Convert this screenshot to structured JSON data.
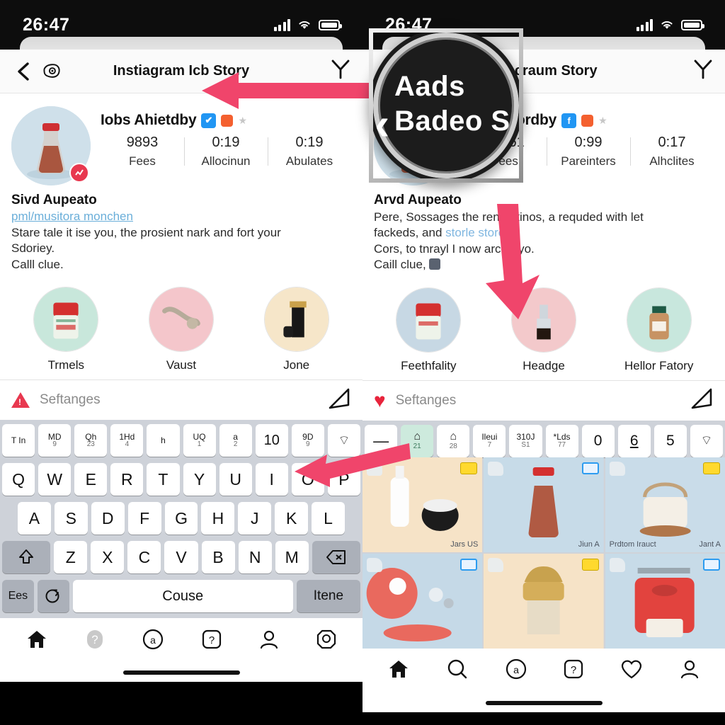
{
  "status_bar": {
    "time": "26:47",
    "signal_icon": "cellular-bars-icon",
    "wifi_icon": "wifi-icon",
    "battery_icon": "battery-icon"
  },
  "left_phone": {
    "nav": {
      "back_icon": "back-chevron-icon",
      "logo_icon": "camera-logo-icon",
      "title": "Instiagram Icb Story",
      "filter_icon": "filter-y-icon"
    },
    "profile": {
      "avatar_icon": "sauce-bottle-avatar",
      "avatar_badge_icon": "reel-badge-icon",
      "username": "Iobs Ahietdby",
      "verified_icon": "verified-check-icon",
      "emoji_icon": "orange-emoji-icon",
      "star_icon": "star-icon",
      "stats": [
        {
          "value": "9893",
          "label": "Fees"
        },
        {
          "value": "0:19",
          "label": "Allocinun"
        },
        {
          "value": "0:19",
          "label": "Abulates"
        }
      ]
    },
    "bio": {
      "title": "Sivd Aupeato",
      "link": "pml/musitora monchen",
      "line1": "Stare tale it ise you, the prosient nark and fort your",
      "line2": "Sdoriey.",
      "line3": "Calll clue."
    },
    "highlights": [
      {
        "label": "Trmels",
        "icon": "red-tin-thumb",
        "badge_icon": "reel-badge-icon"
      },
      {
        "label": "Vaust",
        "icon": "ornament-thumb",
        "badge_icon": "reel-badge-icon"
      },
      {
        "label": "Jone",
        "icon": "black-bottle-thumb",
        "badge_icon": ""
      }
    ],
    "strip": {
      "icon": "warning-triangle-icon",
      "text": "Seftanges",
      "action_icon": "share-arrow-icon"
    },
    "keyboard": {
      "suggestion_row": [
        {
          "main": "T In",
          "sub": ""
        },
        {
          "main": "MD",
          "sub": "9"
        },
        {
          "main": "Qh",
          "sub": "23"
        },
        {
          "main": "1Hd",
          "sub": "4"
        },
        {
          "main": "h",
          "sub": ""
        },
        {
          "main": "UQ",
          "sub": "1"
        },
        {
          "main": "a",
          "sub": "2"
        },
        {
          "main": "10",
          "sub": ""
        },
        {
          "main": "9D",
          "sub": "9"
        },
        {
          "main": "⌔",
          "sub": ""
        }
      ],
      "row1": [
        "Q",
        "W",
        "E",
        "R",
        "T",
        "Y",
        "U",
        "I",
        "O",
        "P"
      ],
      "row2": [
        "A",
        "S",
        "D",
        "F",
        "G",
        "H",
        "J",
        "K",
        "L"
      ],
      "row3": [
        "Z",
        "X",
        "C",
        "V",
        "B",
        "N",
        "M"
      ],
      "shift_icon": "shift-arrow-icon",
      "backspace_icon": "backspace-icon",
      "bottom_left": "Ees",
      "globe_icon": "globe-refresh-icon",
      "space_label": "Couse",
      "return_label": "Itene"
    },
    "tabbar": [
      {
        "icon": "home-icon",
        "active": true
      },
      {
        "icon": "search-icon-disabled",
        "active": false
      },
      {
        "icon": "reels-circle-icon",
        "active": false
      },
      {
        "icon": "question-square-icon",
        "active": false
      },
      {
        "icon": "person-icon",
        "active": false
      },
      {
        "icon": "tagged-frame-icon",
        "active": false
      }
    ]
  },
  "right_phone": {
    "nav": {
      "back_icon": "back-chevron-icon",
      "title": "dsacraum Story",
      "filter_icon": "filter-y-icon"
    },
    "profile": {
      "avatar_icon": "sauce-bottle-avatar",
      "avatar_badge_icon": "reel-badge-icon",
      "username": "oue Ahiordby",
      "verified_icon": "facebook-badge-icon",
      "emoji_icon": "orange-emoji-icon",
      "star_icon": "star-icon",
      "stats": [
        {
          "value": "33661",
          "label": "Fees"
        },
        {
          "value": "0:99",
          "label": "Pareinters"
        },
        {
          "value": "0:17",
          "label": "Alhclites"
        }
      ]
    },
    "bio": {
      "title": "Arvd Aupeato",
      "line1": "Pere, Sossages the renerstinos, a requded with let",
      "line2a": "fackeds, and ",
      "line2_link": "storle store",
      "line2b": ",",
      "line3": "Cors, to tnrayl I now archb-yo.",
      "line4": "Caill clue,"
    },
    "highlights": [
      {
        "label": "Feethfality",
        "icon": "red-tin-thumb",
        "badge_icon": "reel-badge-icon"
      },
      {
        "label": "Headge",
        "icon": "dark-bottle-thumb",
        "badge_icon": ""
      },
      {
        "label": "Hellor Fatory",
        "icon": "jar-thumb",
        "badge_icon": ""
      }
    ],
    "strip": {
      "icon": "heart-filled-icon",
      "text": "Seftanges",
      "action_icon": "share-arrow-icon"
    },
    "keyboard": {
      "suggestion_row": [
        {
          "main": "—",
          "sub": ""
        },
        {
          "main": "⌂",
          "sub": "21"
        },
        {
          "main": "⌂",
          "sub": "28"
        },
        {
          "main": "Ileui",
          "sub": "7"
        },
        {
          "main": "310J",
          "sub": "S1"
        },
        {
          "main": "*Lds",
          "sub": "77"
        },
        {
          "main": "0",
          "sub": ""
        },
        {
          "main": "6",
          "sub": ""
        },
        {
          "main": "5",
          "sub": ""
        },
        {
          "main": "⌔",
          "sub": ""
        }
      ]
    },
    "grid": [
      {
        "caption": "Jars US",
        "tag": "yellow",
        "bg": "cream",
        "thumb": "white-bottle-cup"
      },
      {
        "caption": "Jiun A",
        "tag": "blue",
        "bg": "blue",
        "thumb": "sauce-bottle"
      },
      {
        "caption": "Jant A",
        "caption_left": "Prdtom Irauct",
        "tag": "yellow",
        "bg": "blue",
        "thumb": "basket-jar"
      },
      {
        "caption": "",
        "tag": "blue",
        "bg": "blue",
        "thumb": "red-dish"
      },
      {
        "caption": "",
        "tag": "yellow",
        "bg": "cream",
        "thumb": "gold-crown-jar"
      },
      {
        "caption": "",
        "tag": "blue",
        "bg": "blue",
        "thumb": "red-canister"
      }
    ],
    "tabbar": [
      {
        "icon": "home-icon",
        "active": true
      },
      {
        "icon": "search-icon",
        "active": false
      },
      {
        "icon": "reels-circle-icon",
        "active": false
      },
      {
        "icon": "question-square-icon",
        "active": false
      },
      {
        "icon": "heart-outline-icon",
        "active": false
      },
      {
        "icon": "person-icon",
        "active": false
      }
    ]
  },
  "annotations": {
    "magnifier": {
      "line1": "Aads",
      "line2": "Badeo S",
      "caret_icon": "back-chevron-icon"
    },
    "arrow_color": "#f0456b",
    "arrows": [
      {
        "name": "arrow-to-title"
      },
      {
        "name": "arrow-to-highlight"
      },
      {
        "name": "arrow-to-keyboard"
      }
    ]
  }
}
